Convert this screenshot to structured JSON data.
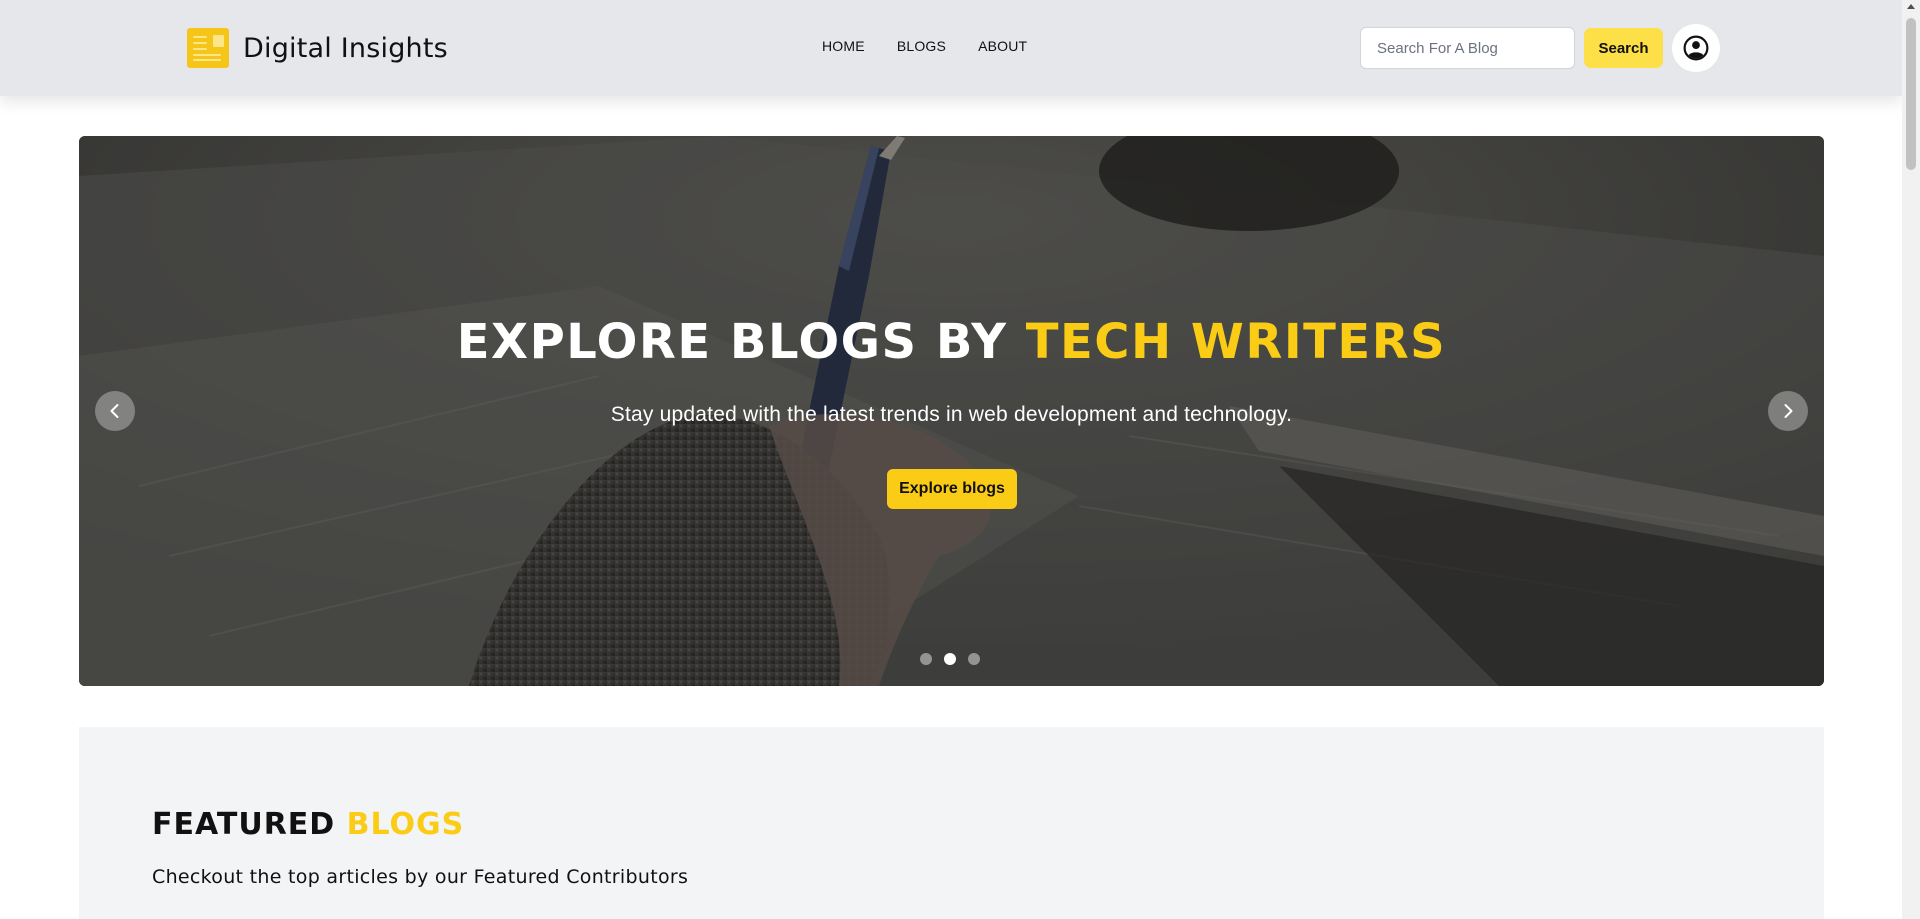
{
  "header": {
    "brand": "Digital Insights",
    "nav": [
      "HOME",
      "BLOGS",
      "ABOUT"
    ],
    "search": {
      "placeholder": "Search For A Blog",
      "value": ""
    },
    "search_button": "Search",
    "icons": {
      "logo": "newspaper-logo-icon",
      "profile": "user-circle-icon"
    }
  },
  "hero": {
    "title_main": "EXPLORE BLOGS BY ",
    "title_accent": "TECH WRITERS",
    "subtitle": "Stay updated with the latest trends in web development and technology.",
    "cta": "Explore blogs",
    "prev_icon": "chevron-left-icon",
    "next_icon": "chevron-right-icon",
    "slides_count": 3,
    "active_slide": 2
  },
  "featured": {
    "title_main": "FEATURED ",
    "title_accent": "BLOGS",
    "subtitle": "Checkout the top articles by our Featured Contributors"
  },
  "colors": {
    "accent": "#facc15",
    "header_bg": "#e5e7eb",
    "section_bg": "#f3f4f6",
    "search_button_bg": "#fde047"
  }
}
